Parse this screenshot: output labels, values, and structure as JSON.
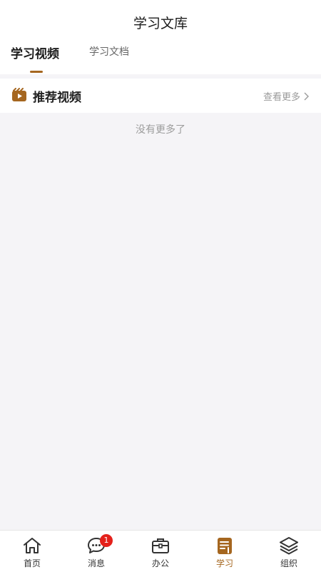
{
  "header": {
    "title": "学习文库"
  },
  "tabs": [
    {
      "label": "学习视频",
      "active": true
    },
    {
      "label": "学习文档",
      "active": false
    }
  ],
  "section": {
    "title": "推荐视频",
    "see_more": "查看更多"
  },
  "empty_message": "没有更多了",
  "colors": {
    "accent": "#a5661f",
    "badge": "#e4211b",
    "page_bg": "#f5f4f7"
  },
  "bottom_nav": {
    "items": [
      {
        "label": "首页",
        "icon": "home-icon"
      },
      {
        "label": "消息",
        "icon": "message-icon",
        "badge": "1"
      },
      {
        "label": "办公",
        "icon": "briefcase-icon"
      },
      {
        "label": "学习",
        "icon": "study-icon",
        "active": true
      },
      {
        "label": "组织",
        "icon": "layers-icon"
      }
    ]
  }
}
